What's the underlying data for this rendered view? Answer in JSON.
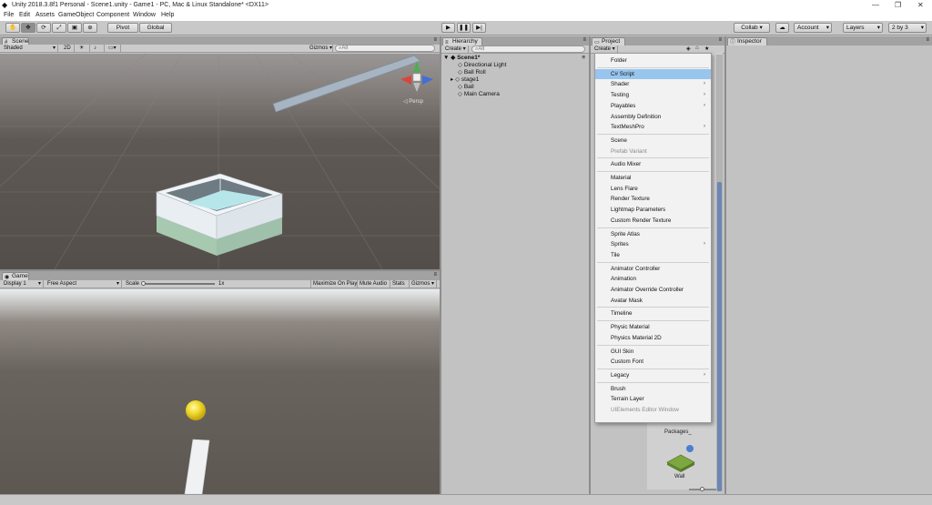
{
  "window": {
    "title": "Unity 2018.3.8f1 Personal - Scene1.unity - Game1 - PC, Mac & Linux Standalone* <DX11>"
  },
  "menubar": [
    "File",
    "Edit",
    "Assets",
    "GameObject",
    "Component",
    "Window",
    "Help"
  ],
  "toolbar": {
    "pivot": "Pivot",
    "global": "Global",
    "collab": "Collab",
    "account": "Account",
    "layers": "Layers",
    "layout": "2 by 3"
  },
  "scene": {
    "tab": "Scene",
    "shading": "Shaded",
    "mode_2d": "2D",
    "gizmos": "Gizmos",
    "search_placeholder": "All",
    "persp": "Persp"
  },
  "game": {
    "tab": "Game",
    "display": "Display 1",
    "aspect": "Free Aspect",
    "scale_label": "Scale",
    "scale_value": "1x",
    "maximize": "Maximize On Play",
    "mute": "Mute Audio",
    "stats": "Stats",
    "gizmos": "Gizmos"
  },
  "hierarchy": {
    "tab": "Hierarchy",
    "create": "Create",
    "search_placeholder": "All",
    "scene_name": "Scene1*",
    "items": [
      "Directional Light",
      "Ball Roll",
      "stage1",
      "Ball",
      "Main Camera"
    ]
  },
  "project": {
    "tab": "Project",
    "create": "Create",
    "assets": [
      "Packages",
      "Wall"
    ]
  },
  "inspector": {
    "tab": "Inspector"
  },
  "create_menu": {
    "items": [
      {
        "label": "Folder"
      },
      {
        "sep": true
      },
      {
        "label": "C# Script",
        "highlighted": true
      },
      {
        "label": "Shader",
        "submenu": true
      },
      {
        "label": "Testing",
        "submenu": true
      },
      {
        "label": "Playables",
        "submenu": true
      },
      {
        "label": "Assembly Definition"
      },
      {
        "label": "TextMeshPro",
        "submenu": true
      },
      {
        "sep": true
      },
      {
        "label": "Scene"
      },
      {
        "label": "Prefab Variant",
        "disabled": true
      },
      {
        "sep": true
      },
      {
        "label": "Audio Mixer"
      },
      {
        "sep": true
      },
      {
        "label": "Material"
      },
      {
        "label": "Lens Flare"
      },
      {
        "label": "Render Texture"
      },
      {
        "label": "Lightmap Parameters"
      },
      {
        "label": "Custom Render Texture"
      },
      {
        "sep": true
      },
      {
        "label": "Sprite Atlas"
      },
      {
        "label": "Sprites",
        "submenu": true
      },
      {
        "label": "Tile"
      },
      {
        "sep": true
      },
      {
        "label": "Animator Controller"
      },
      {
        "label": "Animation"
      },
      {
        "label": "Animator Override Controller"
      },
      {
        "label": "Avatar Mask"
      },
      {
        "sep": true
      },
      {
        "label": "Timeline"
      },
      {
        "sep": true
      },
      {
        "label": "Physic Material"
      },
      {
        "label": "Physics Material 2D"
      },
      {
        "sep": true
      },
      {
        "label": "GUI Skin"
      },
      {
        "label": "Custom Font"
      },
      {
        "sep": true
      },
      {
        "label": "Legacy",
        "submenu": true
      },
      {
        "sep": true
      },
      {
        "label": "Brush"
      },
      {
        "label": "Terrain Layer"
      },
      {
        "label": "UIElements Editor Window",
        "disabled": true
      }
    ]
  },
  "colors": {
    "highlight": "#98c5ee",
    "panel": "#c2c2c2",
    "header": "#a2a2a2",
    "ball": "#f2dc2e",
    "scrollbar": "#6b86b3"
  }
}
